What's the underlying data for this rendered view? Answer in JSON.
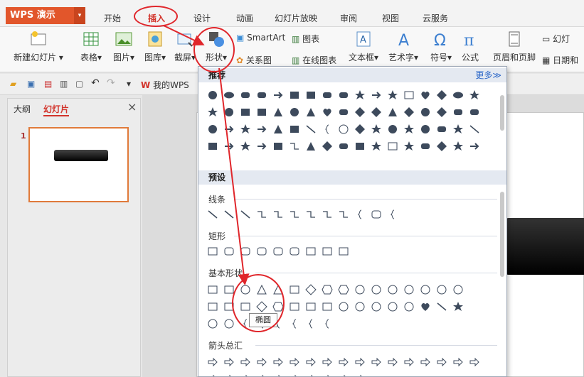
{
  "app": {
    "logo": "WPS 演示"
  },
  "tabs": [
    "开始",
    "插入",
    "设计",
    "动画",
    "幻灯片放映",
    "审阅",
    "视图",
    "云服务"
  ],
  "ribbon": {
    "new_slide": "新建幻灯片",
    "table": "表格",
    "image": "图片",
    "gallery": "图库",
    "screenshot": "截屏",
    "shapes": "形状",
    "smartart": "SmartArt",
    "chart": "图表",
    "relation": "关系图",
    "online_chart": "在线图表",
    "textbox": "文本框",
    "wordart": "艺术字",
    "symbol": "符号",
    "formula": "公式",
    "header_footer": "页眉和页脚",
    "slide_no": "幻灯",
    "datetime": "日期和"
  },
  "quick": {
    "doc_tab": "我的WPS"
  },
  "left_panel": {
    "tab_outline": "大纲",
    "tab_slides": "幻灯片",
    "slide_number": "1"
  },
  "dropdown": {
    "recommend": "推荐",
    "more": "更多≫",
    "presets": "预设",
    "cat_lines": "线条",
    "cat_rect": "矩形",
    "cat_basic": "基本形状",
    "cat_arrows": "箭头总汇"
  },
  "tooltip": "椭圆",
  "colors": {
    "accent": "#d2332a",
    "logo_bg": "#e2562b",
    "annotation": "#e0262b"
  }
}
